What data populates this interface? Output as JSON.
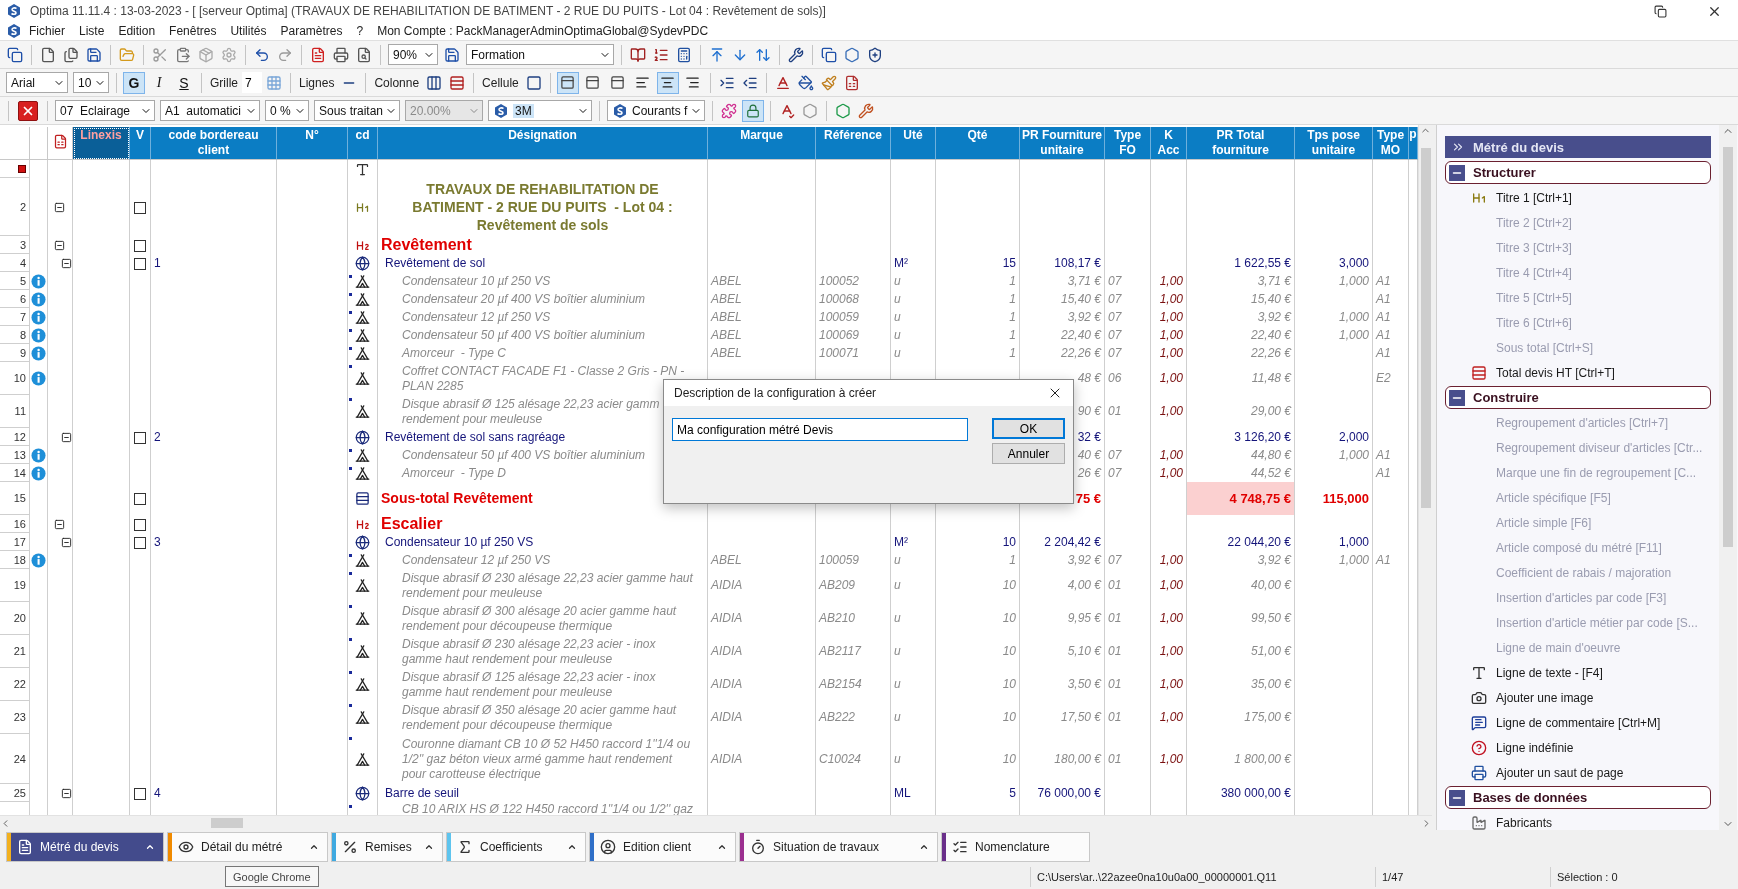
{
  "window": {
    "title": "Optima 11.11.4 : 13-03-2023 - [ [serveur Optima] (TRAVAUX DE REHABILITATION DE BATIMENT - 2 RUE DU PUITS  - Lot 04 : Revêtement de sols)]"
  },
  "menu": {
    "items": [
      "Fichier",
      "Liste",
      "Edition",
      "Fenêtres",
      "Utilités",
      "Paramètres",
      "?"
    ],
    "account": "Mon Compte : PackManagerAdminOptimaGlobal@SydevPDC"
  },
  "toolbar": {
    "zoom": "90%",
    "profile": "Formation"
  },
  "format_bar": {
    "font": "Arial",
    "size": "10",
    "styles": [
      {
        "label": "G",
        "selected": true
      },
      {
        "label": "I",
        "selected": false
      },
      {
        "label": "S",
        "selected": false
      }
    ],
    "grid_label": "Grille",
    "grid_value": "7",
    "lines_label": "Lignes",
    "column_label": "Colonne",
    "cell_label": "Cellule",
    "border_buttons": [
      {
        "selected": true
      },
      {
        "selected": false
      },
      {
        "selected": false
      }
    ],
    "align_buttons": [
      {
        "selected": false
      },
      {
        "selected": true
      },
      {
        "selected": false
      }
    ]
  },
  "article_bar": {
    "lot": "07  Eclairage",
    "tva": "A1  automatici",
    "discount": "0 %",
    "subcontract": "Sous traitan",
    "rate": "20.00%",
    "rate_disabled": true,
    "supplier": "3M",
    "category": "Courants f",
    "lock_selected": true
  },
  "table": {
    "columns": [
      "Linexis",
      "V",
      "code bordereau\nclient",
      "N°",
      "cd",
      "Désignation",
      "Marque",
      "Référence",
      "Uté",
      "Qté",
      "PR Fourniture\nunitaire",
      "Type\nFO",
      "K\nAcc",
      "PR Total\nfourniture",
      "Tps pose\nunitaire",
      "Type\nMO",
      "p"
    ],
    "rows": [
      {
        "kind": "text",
        "current": true
      },
      {
        "n": "2",
        "kind": "title1",
        "expanded": true,
        "checked": false,
        "designation": "TRAVAUX DE REHABILITATION DE\nBATIMENT - 2 RUE DU PUITS  - Lot 04 :\nRevêtement de sols"
      },
      {
        "n": "3",
        "kind": "title2",
        "expanded": true,
        "checked": false,
        "designation": "Revêtement"
      },
      {
        "n": "4",
        "kind": "composite",
        "expanded": true,
        "checked": false,
        "code": "1",
        "designation": "Revêtement de sol",
        "ute": "M²",
        "qte": "15",
        "pr": "108,17 €",
        "total": "1 622,55 €",
        "tps": "3,000"
      },
      {
        "n": "5",
        "kind": "article",
        "info": true,
        "designation": "Condensateur 10 µf 250 VS",
        "marque": "ABEL",
        "ref": "100052",
        "ute": "u",
        "qte": "1",
        "pr": "3,71 €",
        "fo": "07",
        "k": "1,00",
        "total": "3,71 €",
        "tps": "1,000",
        "mo": "A1"
      },
      {
        "n": "6",
        "kind": "article",
        "info": true,
        "designation": "Condensateur 20 µf 400 VS boîtier aluminium",
        "marque": "ABEL",
        "ref": "100068",
        "ute": "u",
        "qte": "1",
        "pr": "15,40 €",
        "fo": "07",
        "k": "1,00",
        "total": "15,40 €",
        "mo": "A1"
      },
      {
        "n": "7",
        "kind": "article",
        "info": true,
        "designation": "Condensateur 12 µf 250 VS",
        "marque": "ABEL",
        "ref": "100059",
        "ute": "u",
        "qte": "1",
        "pr": "3,92 €",
        "fo": "07",
        "k": "1,00",
        "total": "3,92 €",
        "tps": "1,000",
        "mo": "A1"
      },
      {
        "n": "8",
        "kind": "article",
        "info": true,
        "designation": "Condensateur 50 µf 400 VS boîtier aluminium",
        "marque": "ABEL",
        "ref": "100069",
        "ute": "u",
        "qte": "1",
        "pr": "22,40 €",
        "fo": "07",
        "k": "1,00",
        "total": "22,40 €",
        "tps": "1,000",
        "mo": "A1"
      },
      {
        "n": "9",
        "kind": "article",
        "info": true,
        "designation": "Amorceur  - Type C",
        "marque": "ABEL",
        "ref": "100071",
        "ute": "u",
        "qte": "1",
        "pr": "22,26 €",
        "fo": "07",
        "k": "1,00",
        "total": "22,26 €",
        "mo": "A1"
      },
      {
        "n": "10",
        "kind": "article",
        "info": true,
        "designation": "Coffret CONTACT FACADE F1 - Classe 2 Gris - PN -\nPLAN 2285",
        "pr": "48 €",
        "fo": "06",
        "k": "1,00",
        "total": "11,48 €",
        "mo": "E2"
      },
      {
        "n": "11",
        "kind": "article",
        "info": false,
        "designation": "Disque abrasif Ø 125 alésage 22,23 acier gamm\nrendement pour meuleuse",
        "pr": "90 €",
        "fo": "01",
        "k": "1,00",
        "total": "29,00 €"
      },
      {
        "n": "12",
        "kind": "composite",
        "expanded": true,
        "checked": false,
        "code": "2",
        "designation": "Revêtement de sol sans ragréage",
        "pr": "32 €",
        "total": "3 126,20 €",
        "tps": "2,000"
      },
      {
        "n": "13",
        "kind": "article",
        "info": true,
        "designation": "Condensateur 50 µf 400 VS boîtier aluminium",
        "pr": "40 €",
        "fo": "07",
        "k": "1,00",
        "total": "44,80 €",
        "tps": "1,000",
        "mo": "A1"
      },
      {
        "n": "14",
        "kind": "article",
        "info": true,
        "designation": "Amorceur  - Type D",
        "pr": "26 €",
        "fo": "07",
        "k": "1,00",
        "total": "44,52 €",
        "mo": "A1"
      },
      {
        "n": "15",
        "kind": "subtotal",
        "checked": false,
        "designation": "Sous-total Revêtement",
        "pr": "75 €",
        "total": "4 748,75 €",
        "tps": "115,000"
      },
      {
        "n": "16",
        "kind": "title2",
        "expanded": true,
        "checked": false,
        "designation": "Escalier"
      },
      {
        "n": "17",
        "kind": "composite",
        "expanded": true,
        "checked": false,
        "code": "3",
        "designation": "Condensateur 10 µf 250 VS",
        "ute": "M²",
        "qte": "10",
        "pr": "2 204,42 €",
        "total": "22 044,20 €",
        "tps": "1,000"
      },
      {
        "n": "18",
        "kind": "article",
        "info": true,
        "designation": "Condensateur 12 µf 250 VS",
        "marque": "ABEL",
        "ref": "100059",
        "ute": "u",
        "qte": "1",
        "pr": "3,92 €",
        "fo": "07",
        "k": "1,00",
        "total": "3,92 €",
        "tps": "1,000",
        "mo": "A1"
      },
      {
        "n": "19",
        "kind": "article",
        "info": false,
        "designation": "Disque abrasif Ø 230 alésage 22,23 acier gamme haut\nrendement pour meuleuse",
        "marque": "AIDIA",
        "ref": "AB209",
        "ute": "u",
        "qte": "10",
        "pr": "4,00 €",
        "fo": "01",
        "k": "1,00",
        "total": "40,00 €"
      },
      {
        "n": "20",
        "kind": "article",
        "info": false,
        "designation": "Disque abrasif Ø 300 alésage 20 acier gamme haut\nrendement pour découpeuse thermique",
        "marque": "AIDIA",
        "ref": "AB210",
        "ute": "u",
        "qte": "10",
        "pr": "9,95 €",
        "fo": "01",
        "k": "1,00",
        "total": "99,50 €"
      },
      {
        "n": "21",
        "kind": "article",
        "info": false,
        "designation": "Disque abrasif Ø 230 alésage 22,23 acier - inox\ngamme haut rendement pour meuleuse",
        "marque": "AIDIA",
        "ref": "AB2117",
        "ute": "u",
        "qte": "10",
        "pr": "5,10 €",
        "fo": "01",
        "k": "1,00",
        "total": "51,00 €"
      },
      {
        "n": "22",
        "kind": "article",
        "info": false,
        "designation": "Disque abrasif Ø 125 alésage 22,23 acier - inox\ngamme haut rendement pour meuleuse",
        "marque": "AIDIA",
        "ref": "AB2154",
        "ute": "u",
        "qte": "10",
        "pr": "3,50 €",
        "fo": "01",
        "k": "1,00",
        "total": "35,00 €"
      },
      {
        "n": "23",
        "kind": "article",
        "info": false,
        "designation": "Disque abrasif Ø 350 alésage 20 acier gamme haut\nrendement pour découpeuse thermique",
        "marque": "AIDIA",
        "ref": "AB222",
        "ute": "u",
        "qte": "10",
        "pr": "17,50 €",
        "fo": "01",
        "k": "1,00",
        "total": "175,00 €"
      },
      {
        "n": "24",
        "kind": "article",
        "info": false,
        "designation": "Couronne diamant CB 10 Ø 52 H450 raccord 1''1/4 ou\n1/2'' gaz béton vieux armé gamme haut rendement\npour carotteuse électrique",
        "marque": "AIDIA",
        "ref": "C10024",
        "ute": "u",
        "qte": "10",
        "pr": "180,00 €",
        "fo": "01",
        "k": "1,00",
        "total": "1 800,00 €"
      },
      {
        "n": "25",
        "kind": "composite",
        "expanded": true,
        "checked": false,
        "code": "4",
        "designation": "Barre de seuil",
        "ute": "ML",
        "qte": "5",
        "pr": "76 000,00 €",
        "total": "380 000,00 €"
      },
      {
        "kind": "article_partial",
        "designation": "CB 10 ARIX HS Ø 122 H450 raccord 1''1/4 ou 1/2'' gaz"
      }
    ]
  },
  "dialog": {
    "title": "Description de la configuration à créer",
    "value": "Ma configuration métré Devis",
    "buttons": [
      {
        "label": "OK",
        "default": true
      },
      {
        "label": "Annuler",
        "default": false
      }
    ]
  },
  "panel": {
    "title": "Métré du devis",
    "sections": [
      {
        "title": "Structurer",
        "expanded": true,
        "items": [
          {
            "label": "Titre 1 [Ctrl+1]",
            "disabled": false
          },
          {
            "label": "Titre 2 [Ctrl+2]",
            "disabled": true
          },
          {
            "label": "Titre 3 [Ctrl+3]",
            "disabled": true
          },
          {
            "label": "Titre 4 [Ctrl+4]",
            "disabled": true
          },
          {
            "label": "Titre 5 [Ctrl+5]",
            "disabled": true
          },
          {
            "label": "Titre 6 [Ctrl+6]",
            "disabled": true
          },
          {
            "label": "Sous total [Ctrl+S]",
            "disabled": true
          },
          {
            "label": "Total devis HT [Ctrl+T]",
            "disabled": false
          }
        ]
      },
      {
        "title": "Construire",
        "expanded": true,
        "items": [
          {
            "label": "Regroupement d'articles  [Ctrl+7]",
            "disabled": true
          },
          {
            "label": "Regroupement diviseur d'articles [Ctr...",
            "disabled": true
          },
          {
            "label": "Marque une fin de regroupement  [C...",
            "disabled": true
          },
          {
            "label": "Article spécifique [F5]",
            "disabled": true
          },
          {
            "label": "Article simple [F6]",
            "disabled": true
          },
          {
            "label": "Article composé du métré [F11]",
            "disabled": true
          },
          {
            "label": "Coefficient de rabais / majoration",
            "disabled": true
          },
          {
            "label": "Insertion d'articles par code [F3]",
            "disabled": true
          },
          {
            "label": "Insertion d'article métier par code [S...",
            "disabled": true
          },
          {
            "label": "Ligne de main d'oeuvre",
            "disabled": true
          },
          {
            "label": "Ligne de texte - [F4]",
            "disabled": false
          },
          {
            "label": "Ajouter une image",
            "disabled": false
          },
          {
            "label": "Ligne de commentaire [Ctrl+M]",
            "disabled": false
          },
          {
            "label": "Ligne indéfinie",
            "disabled": false
          },
          {
            "label": "Ajouter un saut de page",
            "disabled": false
          }
        ]
      },
      {
        "title": "Bases de données",
        "expanded": true,
        "items": [
          {
            "label": "Fabricants",
            "disabled": false
          }
        ]
      }
    ]
  },
  "bottom_tabs": [
    {
      "label": "Métré du devis",
      "selected": true,
      "color": "#f2b01e",
      "menu": true
    },
    {
      "label": "Détail du métré",
      "selected": false,
      "color": "#f08a00",
      "menu": true
    },
    {
      "label": "Remises",
      "selected": false,
      "color": "#3fa9e0",
      "menu": true
    },
    {
      "label": "Coefficients",
      "selected": false,
      "color": "#5ec4ee",
      "menu": true
    },
    {
      "label": "Edition client",
      "selected": false,
      "color": "#2f6fc8",
      "menu": true
    },
    {
      "label": "Situation de travaux",
      "selected": false,
      "color": "#9b2f8f",
      "menu": true
    },
    {
      "label": "Nomenclature",
      "selected": false,
      "color": "#6a2f8a",
      "menu": false
    }
  ],
  "status_bar": {
    "tooltip": "Google Chrome",
    "path": "C:\\Users\\ar..\\22azee0na10u0a00_00000001.Q11",
    "page": "1/47",
    "selection": "Sélection : 0"
  }
}
